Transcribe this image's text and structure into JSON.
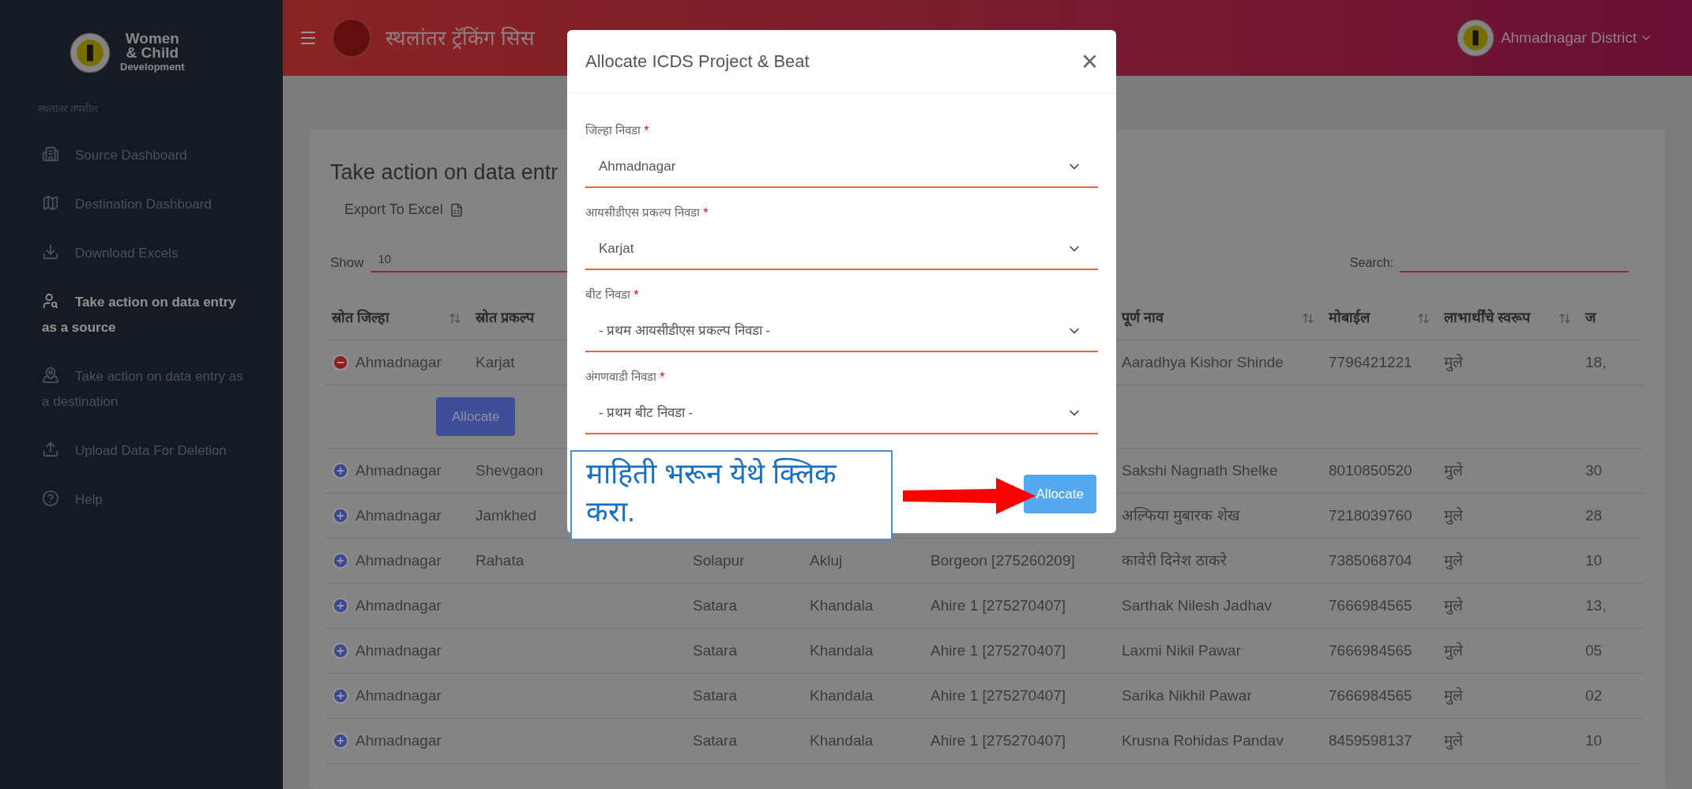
{
  "sidebar": {
    "logo_lines": [
      "Women",
      "& Child",
      "Development"
    ],
    "section": "स्थलांतर तपशील",
    "items": [
      {
        "label": "Source Dashboard",
        "selected": false
      },
      {
        "label": "Destination Dashboard",
        "selected": false
      },
      {
        "label": "Download Excels",
        "selected": false
      },
      {
        "label": "Take action on data entry as a source",
        "selected": true
      },
      {
        "label": "Take action on data entry as a destination",
        "selected": false
      },
      {
        "label": "Upload Data For Deletion",
        "selected": false
      },
      {
        "label": "Help",
        "selected": false
      }
    ]
  },
  "header": {
    "title": "स्थलांतर ट्रॅकिंग सिस",
    "user": "Ahmadnagar District"
  },
  "card": {
    "title": "Take action on data entr",
    "export": "Export To Excel",
    "show_label": "Show",
    "show_value": "10",
    "search_label": "Search:"
  },
  "table": {
    "columns": [
      "स्रोत जिल्हा",
      "स्रोत प्रकल्प",
      null,
      null,
      null,
      "पूर्ण नाव",
      "मोबाईल",
      "लाभार्थींचे स्वरूप",
      "ज"
    ],
    "child_button": "Allocate",
    "rows": [
      {
        "expanded": true,
        "cells": [
          "Ahmadnagar",
          "Karjat",
          null,
          null,
          null,
          "Aaradhya Kishor Shinde",
          "7796421221",
          "मुले",
          "18,"
        ]
      },
      {
        "expanded": false,
        "cells": [
          "Ahmadnagar",
          "Shevgaon",
          null,
          null,
          null,
          "Sakshi Nagnath Shelke",
          "8010850520",
          "मुले",
          "30"
        ]
      },
      {
        "expanded": false,
        "cells": [
          "Ahmadnagar",
          "Jamkhed",
          null,
          null,
          null,
          "अल्फिया मुबारक शेख",
          "7218039760",
          "मुले",
          "28"
        ]
      },
      {
        "expanded": false,
        "cells": [
          "Ahmadnagar",
          "Rahata",
          "Solapur",
          "Akluj",
          "Borgeon [275260209]",
          "कावेरी दिनेश ठाकरे",
          "7385068704",
          "मुले",
          "10"
        ]
      },
      {
        "expanded": false,
        "cells": [
          "Ahmadnagar",
          null,
          "Satara",
          "Khandala",
          "Ahire 1 [275270407]",
          "Sarthak Nilesh Jadhav",
          "7666984565",
          "मुले",
          "13,"
        ]
      },
      {
        "expanded": false,
        "cells": [
          "Ahmadnagar",
          null,
          "Satara",
          "Khandala",
          "Ahire 1 [275270407]",
          "Laxmi Nikil Pawar",
          "7666984565",
          "मुले",
          "05"
        ]
      },
      {
        "expanded": false,
        "cells": [
          "Ahmadnagar",
          null,
          "Satara",
          "Khandala",
          "Ahire 1 [275270407]",
          "Sarika Nikhil Pawar",
          "7666984565",
          "मुले",
          "02"
        ]
      },
      {
        "expanded": false,
        "cells": [
          "Ahmadnagar",
          null,
          "Satara",
          "Khandala",
          "Ahire 1 [275270407]",
          "Krusna Rohidas Pandav",
          "8459598137",
          "मुले",
          "10"
        ]
      }
    ]
  },
  "modal": {
    "title": "Allocate ICDS Project & Beat",
    "close": "×",
    "fields": [
      {
        "label": "जिल्हा निवडा",
        "required_mark": "*",
        "value": "Ahmadnagar"
      },
      {
        "label": "आयसीडीएस प्रकल्प निवडा",
        "required_mark": "*",
        "value": "Karjat"
      },
      {
        "label": "बीट निवडा",
        "required_mark": "*",
        "value": "- प्रथम आयसीडीएस प्रकल्प निवडा -"
      },
      {
        "label": "अंगणवाडी निवडा",
        "required_mark": "*",
        "value": "- प्रथम बीट निवडा -"
      }
    ],
    "button": "Allocate"
  },
  "annotation": {
    "text": "माहिती भरून येथे क्लिक करा."
  }
}
